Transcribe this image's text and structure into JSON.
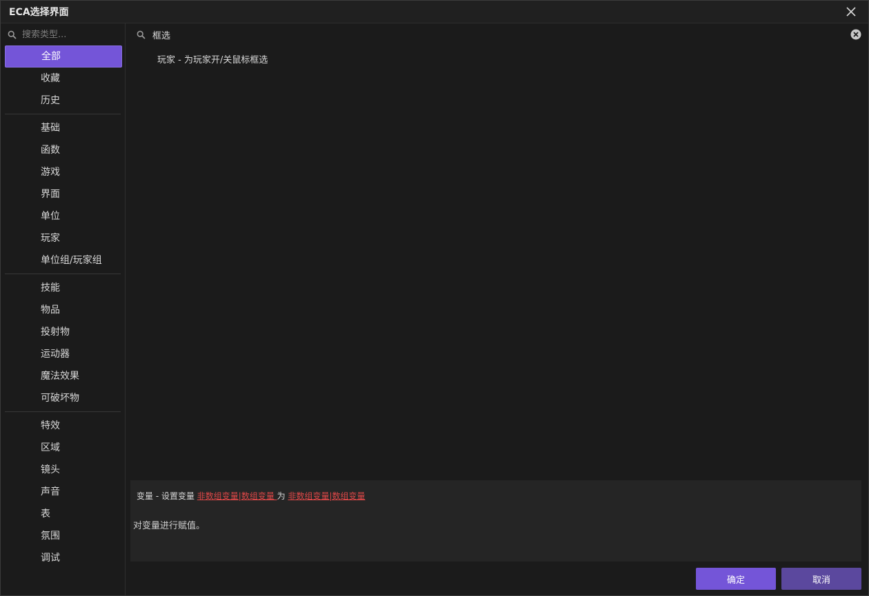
{
  "window": {
    "title": "ECA选择界面"
  },
  "sidebar": {
    "search_placeholder": "搜索类型...",
    "groups": [
      [
        "全部",
        "收藏",
        "历史"
      ],
      [
        "基础",
        "函数",
        "游戏",
        "界面",
        "单位",
        "玩家",
        "单位组/玩家组"
      ],
      [
        "技能",
        "物品",
        "投射物",
        "运动器",
        "魔法效果",
        "可破坏物"
      ],
      [
        "特效",
        "区域",
        "镜头",
        "声音",
        "表",
        "氛围",
        "调试"
      ]
    ],
    "active": "全部"
  },
  "main": {
    "search_value": "框选",
    "results": [
      "玩家 - 为玩家开/关鼠标框选"
    ]
  },
  "description": {
    "prefix": "变量 - 设置变量 ",
    "param1": "非数组变量|数组变量 ",
    "middle": " 为 ",
    "param2": "非数组变量|数组变量 ",
    "text": "对变量进行赋值。"
  },
  "buttons": {
    "ok": "确定",
    "cancel": "取消"
  },
  "colors": {
    "accent": "#7455d8",
    "link": "#e04848"
  },
  "icons": {
    "search": "search-icon",
    "close": "close-icon",
    "clear": "clear-search-icon"
  }
}
